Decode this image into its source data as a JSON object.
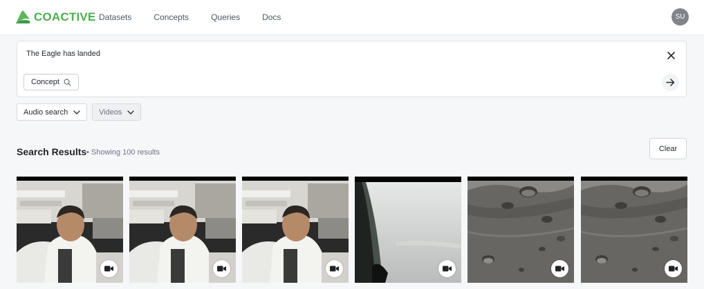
{
  "header": {
    "logo_text": "COACTIVE",
    "nav": [
      {
        "label": "Datasets"
      },
      {
        "label": "Concepts"
      },
      {
        "label": "Queries"
      },
      {
        "label": "Docs"
      }
    ],
    "avatar_initials": "SU"
  },
  "search": {
    "query": "The Eagle has landed",
    "concept_chip_label": "Concept"
  },
  "filters": {
    "mode_label": "Audio search",
    "type_label": "Videos"
  },
  "results": {
    "title": "Search Results",
    "subtitle": "• Showing 100 results",
    "clear_label": "Clear",
    "items": [
      {
        "scene": "control-room",
        "icon": "video-camera-icon"
      },
      {
        "scene": "control-room",
        "icon": "video-camera-icon"
      },
      {
        "scene": "control-room",
        "icon": "video-camera-icon"
      },
      {
        "scene": "window-view",
        "icon": "video-camera-icon"
      },
      {
        "scene": "lunar-surface",
        "icon": "video-camera-icon"
      },
      {
        "scene": "lunar-surface",
        "icon": "video-camera-icon"
      }
    ]
  },
  "colors": {
    "brand": "#4caf50",
    "background": "#f6f7f9"
  }
}
